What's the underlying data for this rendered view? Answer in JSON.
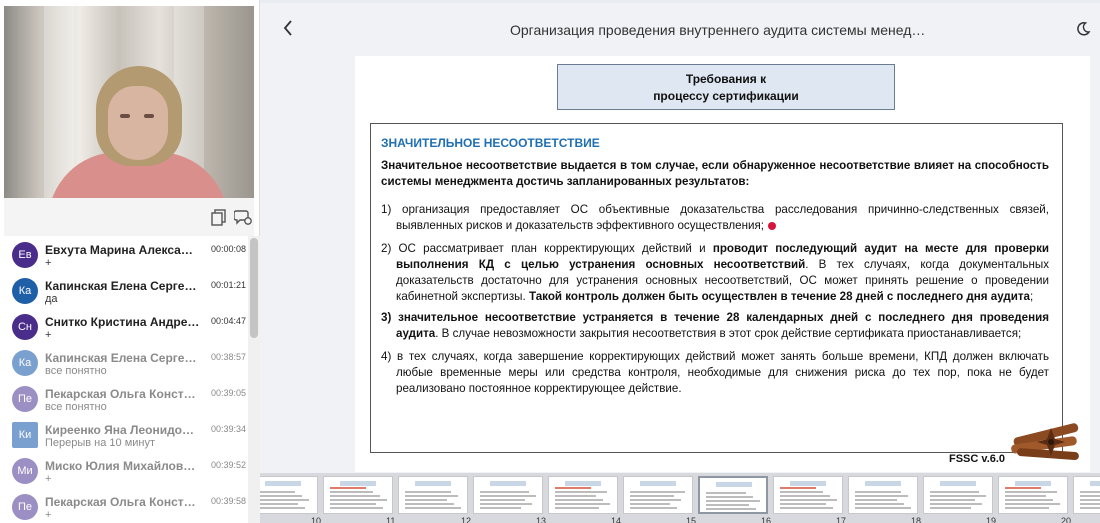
{
  "header": {
    "title": "Организация проведения внутреннего аудита системы менед…",
    "back_icon": "chevron-left-icon",
    "theme_icon": "moon-icon"
  },
  "left_toolbar": {
    "icons": [
      "copy-icon",
      "chat-icon"
    ]
  },
  "chat": [
    {
      "initials": "Ев",
      "name": "Евхута Марина Алекса…",
      "time": "00:00:08",
      "message": "+",
      "color": "#4a2c8a",
      "dim": false
    },
    {
      "initials": "Ка",
      "name": "Капинская Елена Серге…",
      "time": "00:01:21",
      "message": "да",
      "color": "#1f5fa8",
      "dim": false
    },
    {
      "initials": "Сн",
      "name": "Снитко Кристина Андре…",
      "time": "00:04:47",
      "message": "+",
      "color": "#4a2c8a",
      "dim": false
    },
    {
      "initials": "Ка",
      "name": "Капинская Елена Серге…",
      "time": "00:38:57",
      "message": "все понятно",
      "color": "#7aa0d0",
      "dim": true
    },
    {
      "initials": "Пе",
      "name": "Пекарская Ольга Конст…",
      "time": "00:39:05",
      "message": "все понятно",
      "color": "#9c8fc4",
      "dim": true
    },
    {
      "initials": "Ки",
      "name": "Киреенко Яна Леонидо…",
      "time": "00:39:34",
      "message": "Перерыв на 10 минут",
      "color": "#7aa0d0",
      "dim": true
    },
    {
      "initials": "Ми",
      "name": "Миско Юлия Михайлов…",
      "time": "00:39:52",
      "message": "+",
      "color": "#9c8fc4",
      "dim": true
    },
    {
      "initials": "Пе",
      "name": "Пекарская Ольга Конст…",
      "time": "00:39:58",
      "message": "+",
      "color": "#9c8fc4",
      "dim": true
    }
  ],
  "slide": {
    "requirement_line1": "Требования к",
    "requirement_line2": "процессу сертификации",
    "heading": "ЗНАЧИТЕЛЬНОЕ НЕСООТВЕТСТВИЕ",
    "intro": "Значительное несоответствие выдается в том случае, если обнаруженное несоответствие влияет на способность системы менеджмента достичь запланированных результатов:",
    "item1": "1) организация предоставляет ОС объективные доказательства расследования причинно-следственных связей, выявленных рисков и доказательств эффективного осуществления;",
    "item2_a": "2) ОС рассматривает план корректирующих действий и ",
    "item2_b": "проводит последующий аудит на месте для проверки выполнения КД с целью устранения основных несоответствий",
    "item2_c": ". В тех случаях, когда документальных доказательств достаточно для устранения основных несоответствий, ОС может принять решение о проведении кабинетной экспертизы. ",
    "item2_d": "Такой контроль должен быть осуществлен в течение 28 дней с последнего дня аудита",
    "item2_e": ";",
    "item3_a": "3) значительное несоответствие устраняется в течение 28 календарных дней с последнего дня проведения аудита",
    "item3_b": ". В случае невозможности закрытия несоответствия в этот срок действие сертификата приостанавливается;",
    "item4": "4) в тех случаях, когда завершение корректирующих действий может занять больше времени, КПД должен включать любые временные меры или средства контроля, необходимые для снижения риска до тех пор, пока не будет реализовано постоянное корректирующее действие.",
    "footer": "FSSC v.6.0"
  },
  "thumbnails": {
    "numbers": [
      "10",
      "11",
      "12",
      "13",
      "14",
      "15",
      "16",
      "17",
      "18",
      "19",
      "20"
    ],
    "active": "15"
  }
}
